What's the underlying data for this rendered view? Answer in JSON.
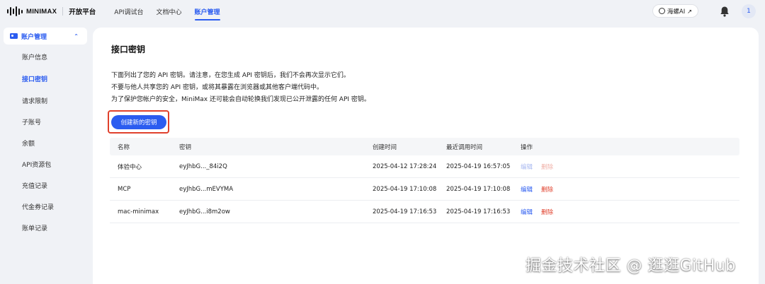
{
  "header": {
    "logo_text": "MINIMAX",
    "brand_sub": "开放平台",
    "nav": [
      {
        "label": "API调试台"
      },
      {
        "label": "文档中心"
      },
      {
        "label": "账户管理",
        "active": true
      }
    ],
    "hailuo_label": "海螺AI ↗",
    "avatar": "1"
  },
  "sidebar": {
    "group_label": "账户管理",
    "items": [
      {
        "label": "账户信息"
      },
      {
        "label": "接口密钥",
        "active": true
      },
      {
        "label": "请求限制"
      },
      {
        "label": "子账号"
      },
      {
        "label": "余额"
      },
      {
        "label": "API资源包"
      },
      {
        "label": "充值记录"
      },
      {
        "label": "代金券记录"
      },
      {
        "label": "账单记录"
      }
    ]
  },
  "main": {
    "title": "接口密钥",
    "desc": [
      "下面列出了您的 API 密钥。请注意，在您生成 API 密钥后，我们不会再次显示它们。",
      "不要与他人共享您的 API 密钥，或将其暴露在浏览器或其他客户端代码中。",
      "为了保护您帐户的安全，MiniMax 还可能会自动轮换我们发现已公开泄露的任何 API 密钥。"
    ],
    "create_button": "创建新的密钥",
    "table": {
      "headers": [
        "名称",
        "密钥",
        "创建时间",
        "最近调用时间",
        "操作"
      ],
      "edit_label": "编辑",
      "delete_label": "删除",
      "rows": [
        {
          "name": "体验中心",
          "key": "eyJhbG..._84i2Q",
          "created": "2025-04-12 17:28:24",
          "last_used": "2025-04-19 16:57:05",
          "actions_disabled": true
        },
        {
          "name": "MCP",
          "key": "eyJhbG...mEVYMA",
          "created": "2025-04-19 17:10:08",
          "last_used": "2025-04-19 17:10:08",
          "actions_disabled": false
        },
        {
          "name": "mac-minimax",
          "key": "eyJhbG...i8m2ow",
          "created": "2025-04-19 17:16:53",
          "last_used": "2025-04-19 17:16:53",
          "actions_disabled": false
        }
      ]
    }
  },
  "watermark": "掘金技术社区 @ 逛逛GitHub",
  "colors": {
    "accent": "#2b5cf0",
    "danger": "#e0402c",
    "highlight_box": "#e0402c"
  }
}
